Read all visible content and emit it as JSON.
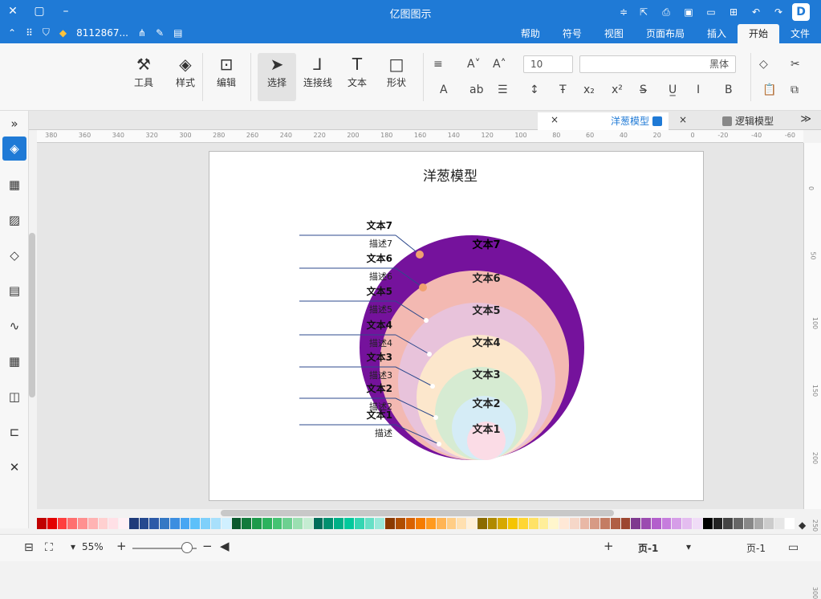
{
  "app": {
    "title": "亿图图示"
  },
  "titlebar": {
    "user": "811286​7...",
    "icons": [
      "close-icon",
      "maximize-icon",
      "minimize-icon",
      "menu-icon",
      "export-icon",
      "print-icon",
      "save-icon",
      "folder-icon",
      "new-icon",
      "undo-icon",
      "redo-icon"
    ]
  },
  "tabs": [
    "文件",
    "开始",
    "插入",
    "页面布局",
    "视图",
    "符号",
    "帮助"
  ],
  "active_tab": "开始",
  "ribbon": {
    "tools_label": "工具",
    "style_label": "样式",
    "edit_label": "编辑",
    "select_label": "选择",
    "connector_label": "连接线",
    "text_label": "文本",
    "shape_label": "形状",
    "font_size": "10",
    "font_name": "黑体"
  },
  "doc_tabs": [
    {
      "label": "洋葱模型",
      "active": true
    },
    {
      "label": "逻辑模型",
      "active": false
    }
  ],
  "diagram": {
    "title": "洋葱模型",
    "layers": [
      {
        "label": "文本7",
        "desc": "描述7",
        "color": "#75129c"
      },
      {
        "label": "文本6",
        "desc": "描述6",
        "color": "#f3b9b2"
      },
      {
        "label": "文本5",
        "desc": "描述5",
        "color": "#e8c3db"
      },
      {
        "label": "文本4",
        "desc": "描述4",
        "color": "#fce7cc"
      },
      {
        "label": "文本3",
        "desc": "描述3",
        "color": "#d6ebd2"
      },
      {
        "label": "文本2",
        "desc": "描述2",
        "color": "#d5ecf6"
      },
      {
        "label": "文本1",
        "desc": "描述",
        "color": "#fbdce6"
      }
    ]
  },
  "ruler_h_labels": [
    "-60",
    "-40",
    "-20",
    "0",
    "20",
    "40",
    "60",
    "80",
    "100",
    "120",
    "140",
    "160",
    "180",
    "200",
    "220",
    "240",
    "260",
    "280",
    "300",
    "320",
    "340",
    "360",
    "380"
  ],
  "ruler_v_labels": [
    "0",
    "50",
    "100",
    "150",
    "200",
    "250",
    "300"
  ],
  "status": {
    "page_label_left": "页-1",
    "page_label_right": "页-1",
    "zoom": "55%"
  },
  "palette": [
    "#c00000",
    "#e30000",
    "#ff3f3f",
    "#ff6f6f",
    "#ff9090",
    "#ffb3b3",
    "#ffd0d0",
    "#ffe0e6",
    "#fff0f5",
    "#1f3b7a",
    "#25498f",
    "#2c5aa8",
    "#3478c4",
    "#3c8ee0",
    "#48a6f3",
    "#5cc0fa",
    "#7fd0fb",
    "#a8e0fc",
    "#d0f0ff",
    "#0b5a2e",
    "#137a3c",
    "#1d9a4b",
    "#2cb25d",
    "#45c373",
    "#6dd091",
    "#9bdfb1",
    "#c5ecd2",
    "#006e5a",
    "#00906f",
    "#00b087",
    "#00c99c",
    "#33d6b2",
    "#66e0c6",
    "#99e9d9",
    "#8b3a00",
    "#b04e00",
    "#d96200",
    "#f57c00",
    "#ff9a1f",
    "#ffb454",
    "#ffcd85",
    "#ffe0b0",
    "#fff0d8",
    "#8b6b00",
    "#b08a00",
    "#d6a800",
    "#f5c400",
    "#ffd633",
    "#ffe266",
    "#ffee99",
    "#fff6cc",
    "#ffe8d6",
    "#f6d7c8",
    "#e9b8a6",
    "#d79a85",
    "#c47c63",
    "#b05f45",
    "#9c4630",
    "#7f3a8f",
    "#9b4bb0",
    "#b35fcc",
    "#c67ddd",
    "#d69ee8",
    "#e4bdf0",
    "#f0dcf7",
    "#000000",
    "#222222",
    "#444444",
    "#666666",
    "#888888",
    "#aaaaaa",
    "#cccccc",
    "#e6e6e6",
    "#ffffff"
  ]
}
